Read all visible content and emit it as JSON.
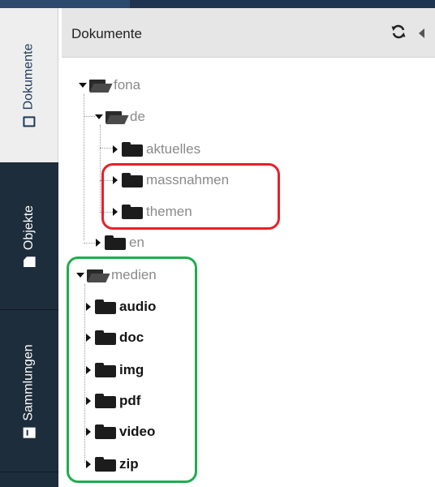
{
  "panel": {
    "title": "Dokumente",
    "refresh_icon": "refresh-icon",
    "collapse_icon": "chevron-left-icon"
  },
  "sidebar_tabs": [
    {
      "label": "Dokumente",
      "icon": "document-icon",
      "active": true
    },
    {
      "label": "Objekte",
      "icon": "file-icon",
      "active": false
    },
    {
      "label": "Sammlungen",
      "icon": "collection-icon",
      "active": false
    },
    {
      "label": "",
      "active": false
    }
  ],
  "tree": {
    "fona": "fona",
    "de": "de",
    "aktuelles": "aktuelles",
    "massnahmen": "massnahmen",
    "themen": "themen",
    "en": "en",
    "medien": "medien",
    "audio": "audio",
    "doc": "doc",
    "img": "img",
    "pdf": "pdf",
    "video": "video",
    "zip": "zip"
  },
  "colors": {
    "rail_bg": "#1e2d3c",
    "active_tab_bg": "#eeeeee",
    "header_bg": "#e6e6e6",
    "annotation_red": "#e8202a",
    "annotation_green": "#1fad4e"
  }
}
